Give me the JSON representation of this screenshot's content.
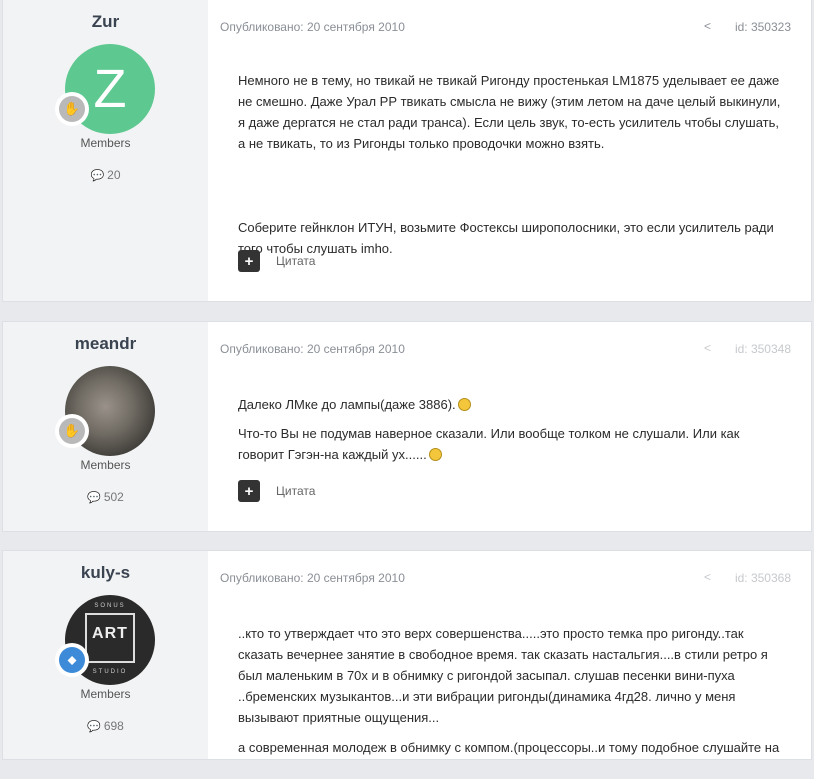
{
  "posts": [
    {
      "author": "Zur",
      "avatar_letter": "Z",
      "group": "Members",
      "post_count": "20",
      "meta": "Опубликовано: 20 сентября 2010",
      "id_label": "id: 350323",
      "paragraphs": [
        "Немного не в тему, но твикай не твикай Ригонду простенькая LM1875 уделывает ее даже не смешно. Даже Урал РР твикать смысла не вижу (этим летом на даче целый выкинули, я даже дергатся не стал ради транса). Если цель звук, то-есть усилитель чтобы слушать, а не твикать, то из Ригонды только проводочки можно взять.",
        "",
        "Соберите гейнклон ИТУН, возьмите Фостексы широполосники, это если усилитель ради того чтобы слушать imho."
      ],
      "quote_label": "Цитата"
    },
    {
      "author": "meandr",
      "group": "Members",
      "post_count": "502",
      "meta": "Опубликовано: 20 сентября 2010",
      "id_label": "id: 350348",
      "paragraphs": [
        "Далеко ЛМке до лампы(даже 3886).",
        "Что-то Вы не подумав наверное сказали. Или вообще толком не слушали. Или как говорит Гэгэн-на каждый ух......"
      ],
      "quote_label": "Цитата"
    },
    {
      "author": "kuly-s",
      "group": "Members",
      "post_count": "698",
      "meta": "Опубликовано: 20 сентября 2010",
      "id_label": "id: 350368",
      "avatar_text": [
        "SONUS",
        "ART",
        "STUDIO"
      ],
      "paragraphs": [
        "..кто то утверждает что это верх совершенства.....это просто темка про ригонду..так сказать вечернее занятие в свободное время. так сказать настальгия....в стили ретро я был маленьким в 70х и в обнимку с ригондой засыпал. слушав песенки вини-пуха ..бременских музыкантов...и эти вибрации ригонды(динамика 4гд28. лично у меня вызывают приятные ощущения...",
        "а современная молодеж в обнимку с компом.(процессоры..и тому подобное слушайте на"
      ]
    }
  ]
}
